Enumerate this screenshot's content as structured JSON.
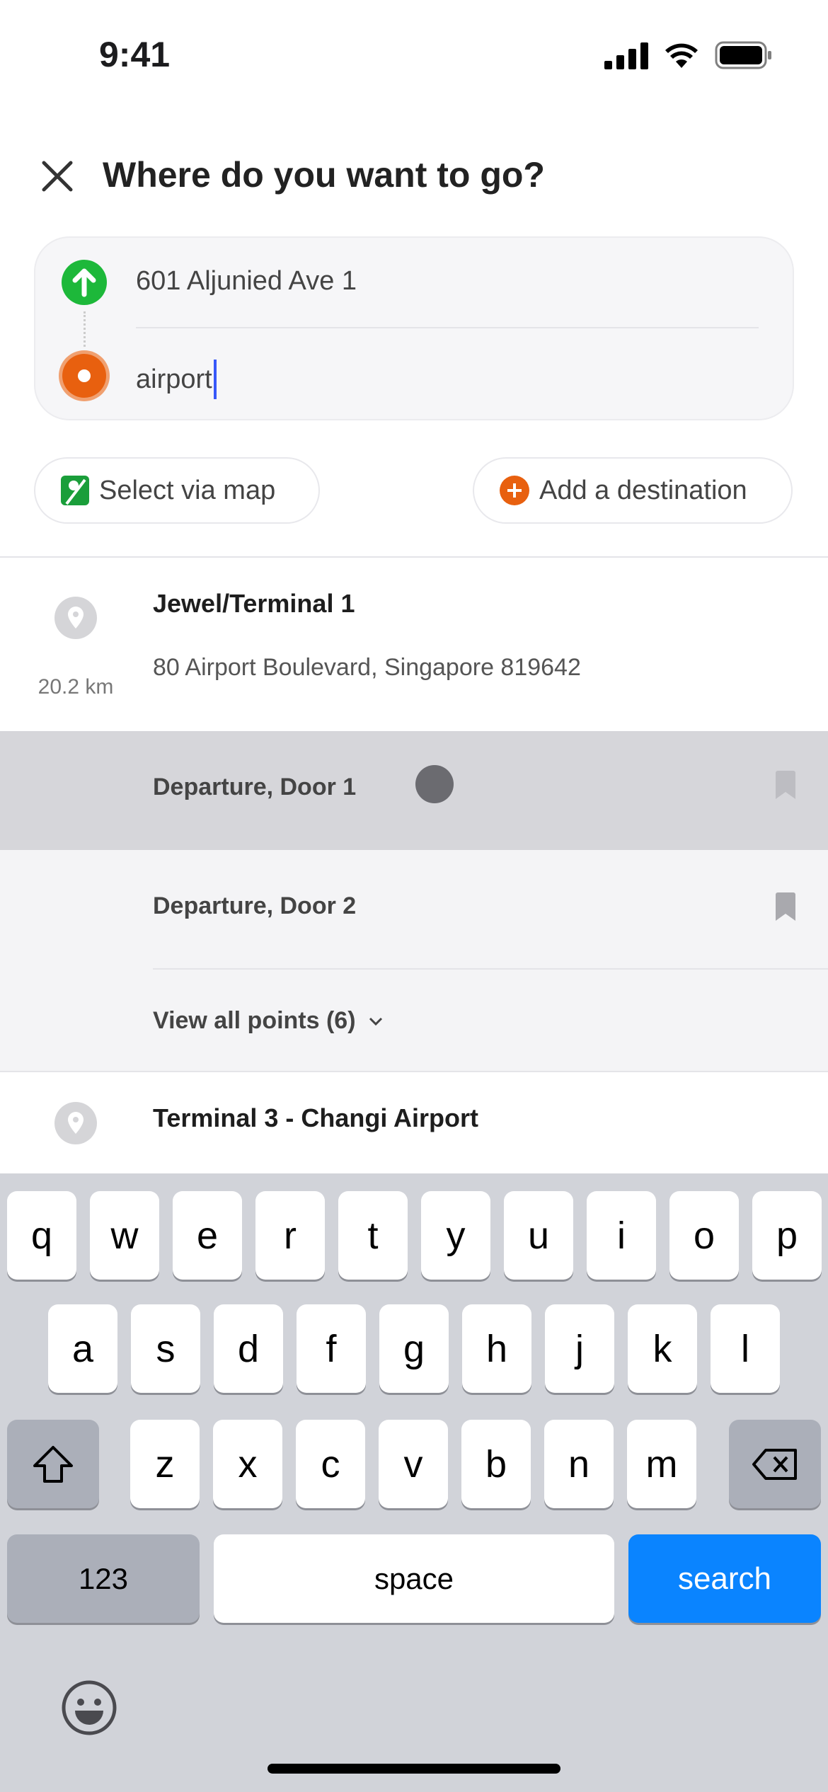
{
  "status": {
    "time": "9:41"
  },
  "header": {
    "title": "Where do you want to go?"
  },
  "route": {
    "origin": "601 Aljunied Ave 1",
    "destination": "airport",
    "colors": {
      "origin": "#1db83a",
      "destination": "#e8600f"
    }
  },
  "actions": {
    "select_map": "Select via map",
    "add_destination": "Add a destination"
  },
  "results": [
    {
      "title": "Jewel/Terminal 1",
      "address": "80 Airport Boulevard, Singapore 819642",
      "distance": "20.2 km",
      "points": [
        {
          "label": "Departure, Door 1"
        },
        {
          "label": "Departure, Door 2"
        }
      ],
      "view_all": "View all points (6)"
    },
    {
      "title": "Terminal 3 - Changi Airport"
    }
  ],
  "keyboard": {
    "row1": [
      "q",
      "w",
      "e",
      "r",
      "t",
      "y",
      "u",
      "i",
      "o",
      "p"
    ],
    "row2": [
      "a",
      "s",
      "d",
      "f",
      "g",
      "h",
      "j",
      "k",
      "l"
    ],
    "row3": [
      "z",
      "x",
      "c",
      "v",
      "b",
      "n",
      "m"
    ],
    "numbers": "123",
    "space": "space",
    "search": "search",
    "accent": "#0a84ff"
  }
}
